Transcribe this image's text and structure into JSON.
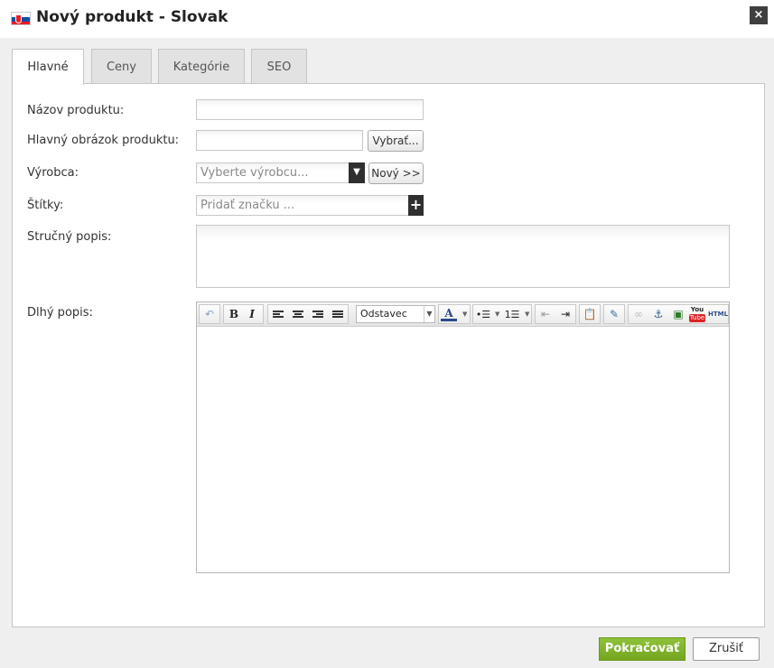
{
  "dialog": {
    "title": "Nový produkt - Slovak",
    "close_label": "×"
  },
  "tabs": [
    {
      "label": "Hlavné",
      "active": true
    },
    {
      "label": "Ceny",
      "active": false
    },
    {
      "label": "Kategórie",
      "active": false
    },
    {
      "label": "SEO",
      "active": false
    }
  ],
  "form": {
    "product_name": {
      "label": "Názov produktu:",
      "value": ""
    },
    "main_image": {
      "label": "Hlavný obrázok produktu:",
      "value": "",
      "button_label": "Vybrať..."
    },
    "manufacturer": {
      "label": "Výrobca:",
      "placeholder": "Vyberte výrobcu...",
      "new_button_label": "Nový >>"
    },
    "tags": {
      "label": "Štítky:",
      "placeholder": "Pridať značku ..."
    },
    "short_description": {
      "label": "Stručný popis:",
      "value": ""
    },
    "long_description": {
      "label": "Dlhý popis:",
      "format_value": "Odstavec"
    }
  },
  "editor_toolbar": {
    "undo_icon": "undo-icon",
    "bold_glyph": "B",
    "italic_glyph": "I",
    "text_color_glyph": "A",
    "html_glyph": "HTML",
    "youtube_glyph_top": "You",
    "youtube_glyph_bottom": "Tube"
  },
  "footer": {
    "continue_label": "Pokračovať",
    "cancel_label": "Zrušiť"
  },
  "colors": {
    "primary": "#7cb02a",
    "tab_inactive": "#e2e2e2",
    "background": "#efefef"
  }
}
